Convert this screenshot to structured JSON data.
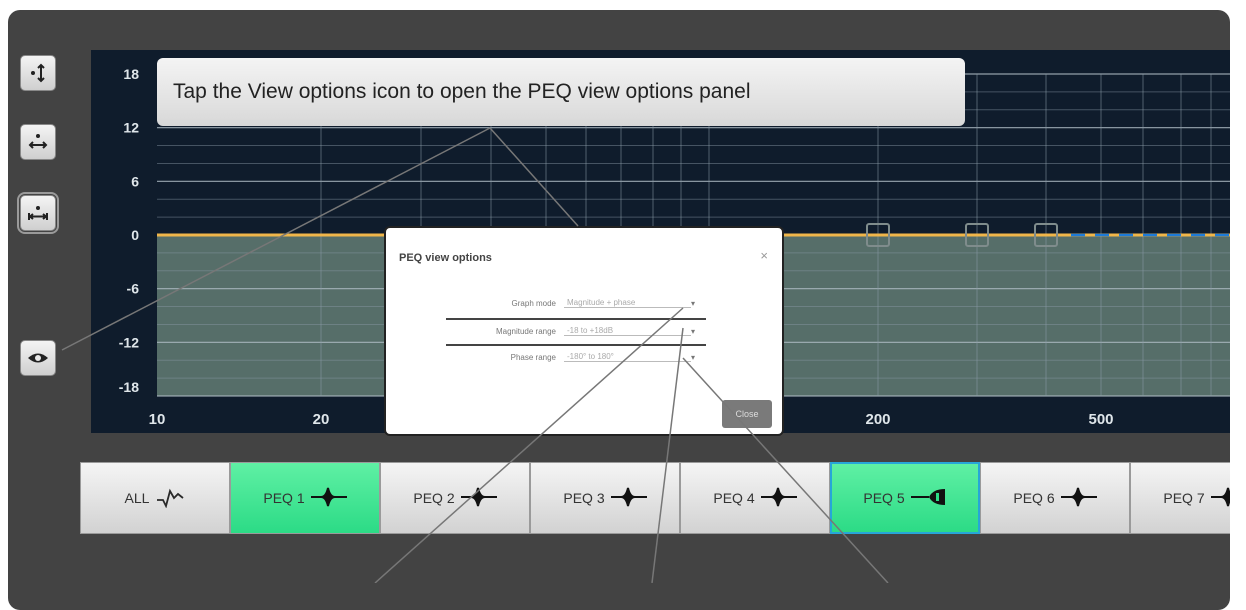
{
  "callout": {
    "text": "Tap the View options icon  to open the PEQ view options panel"
  },
  "side_buttons": [
    {
      "icon": "vertical-zoom-icon"
    },
    {
      "icon": "horizontal-zoom-icon"
    },
    {
      "icon": "fit-width-icon"
    },
    {
      "icon": "eye-icon"
    }
  ],
  "graph": {
    "y_ticks": [
      "18",
      "12",
      "6",
      "0",
      "-6",
      "-12",
      "-18"
    ],
    "x_ticks": [
      "10",
      "20",
      "200",
      "500"
    ],
    "colors": {
      "background": "#0f1c2c",
      "fill": "#566e69",
      "curve": "#f0b64a",
      "grid": "#8a9aa6"
    }
  },
  "dialog": {
    "title": "PEQ view options",
    "close_icon": "×",
    "rows": [
      {
        "label": "Graph mode",
        "value": "Magnitude + phase"
      },
      {
        "label": "Magnitude range",
        "value": "-18 to +18dB"
      },
      {
        "label": "Phase range",
        "value": "-180° to 180°"
      }
    ],
    "dropdown_glyph": "▾",
    "close_label": "Close"
  },
  "peq_buttons": [
    {
      "label": "ALL",
      "icon": "all-curve-icon",
      "state": "normal"
    },
    {
      "label": "PEQ 1",
      "icon": "peak-filter-icon",
      "state": "on"
    },
    {
      "label": "PEQ 2",
      "icon": "peak-filter-icon",
      "state": "normal"
    },
    {
      "label": "PEQ 3",
      "icon": "peak-filter-icon",
      "state": "normal"
    },
    {
      "label": "PEQ 4",
      "icon": "peak-filter-icon",
      "state": "normal"
    },
    {
      "label": "PEQ 5",
      "icon": "high-shelf-icon",
      "state": "selected-on"
    },
    {
      "label": "PEQ 6",
      "icon": "peak-filter-icon",
      "state": "normal"
    },
    {
      "label": "PEQ 7",
      "icon": "peak-filter-icon",
      "state": "normal"
    }
  ]
}
